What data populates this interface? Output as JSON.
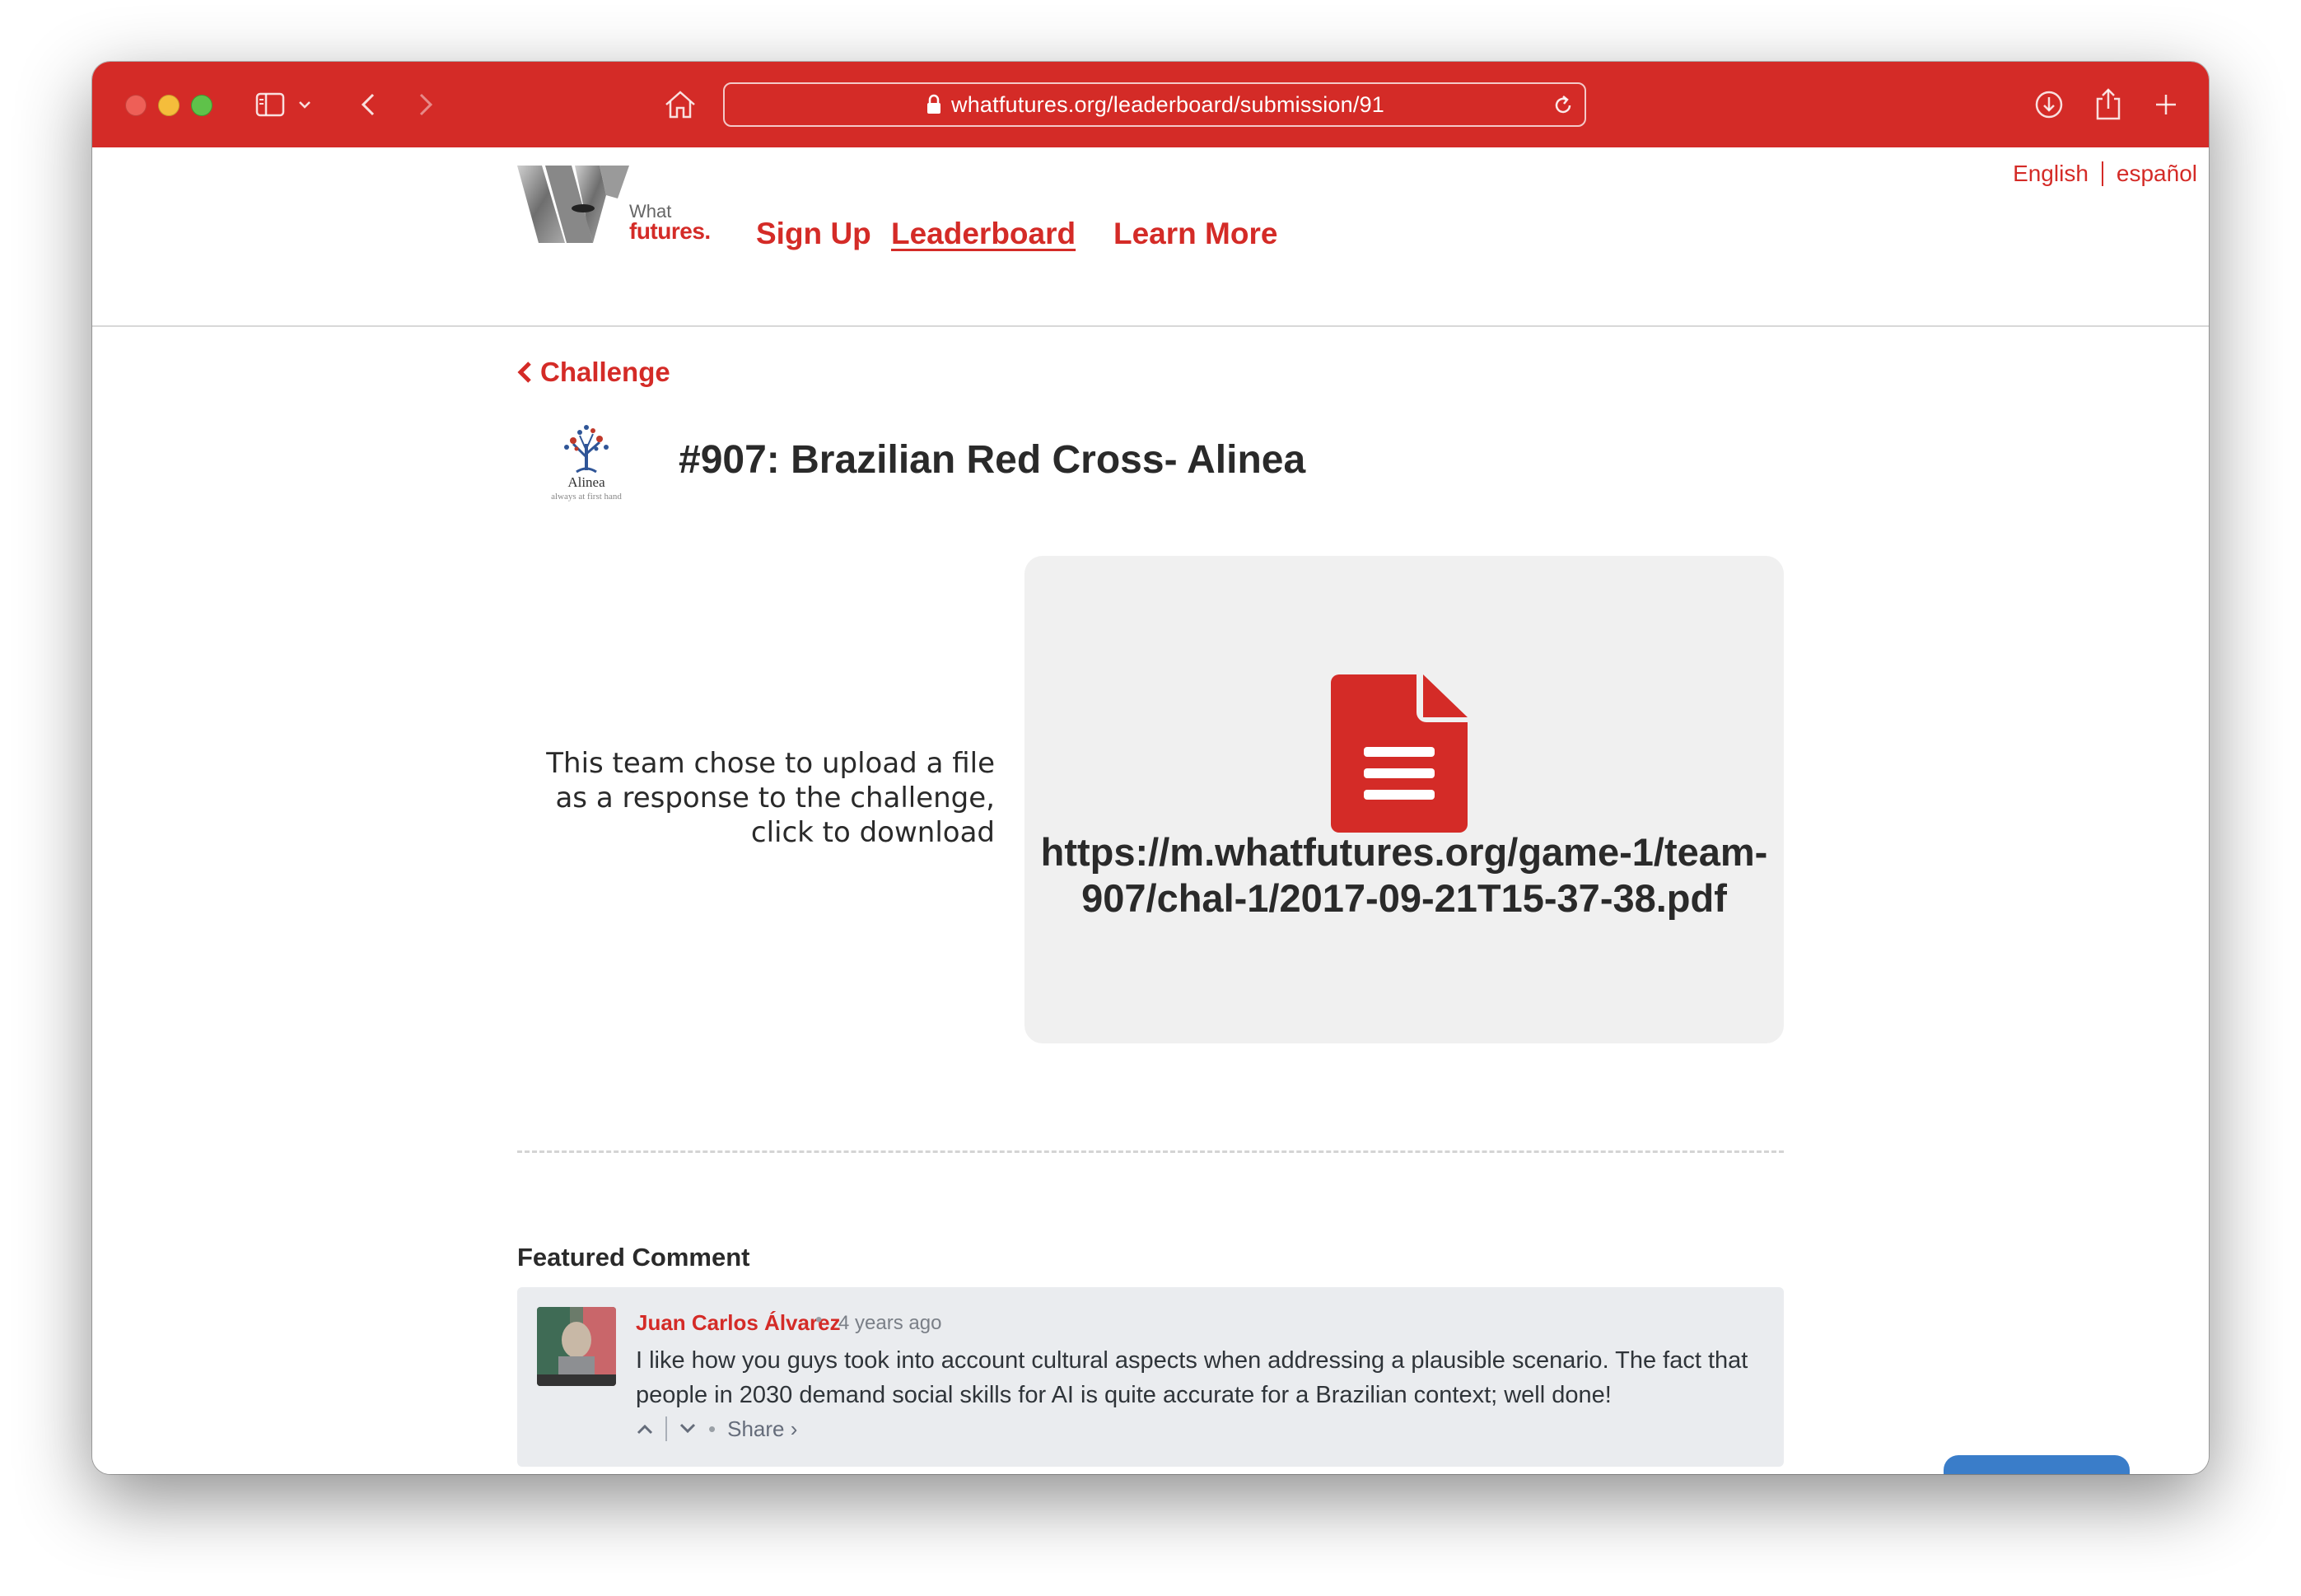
{
  "browser": {
    "url": "whatfutures.org/leaderboard/submission/91"
  },
  "header": {
    "logo_what": "What",
    "logo_futures": "futures.",
    "nav": {
      "signup": "Sign Up",
      "leaderboard": "Leaderboard",
      "learn_more": "Learn More"
    },
    "languages": {
      "english": "English",
      "spanish": "español"
    }
  },
  "content": {
    "back_label": "Challenge",
    "team_logo_name": "Alinea",
    "team_logo_tagline": "always at first hand",
    "title": "#907: Brazilian Red Cross- Alinea",
    "description": "This team chose to upload a file as a response to the challenge, click to download",
    "file_url": "https://m.whatfutures.org/game-1/team-907/chal-1/2017-09-21T15-37-38.pdf"
  },
  "featured": {
    "label": "Featured Comment",
    "comment": {
      "author": "Juan Carlos Álvarez",
      "separator": "•",
      "time": "4 years ago",
      "text": "I like how you guys took into account cultural aspects when addressing a plausible scenario. The fact that people in 2030 demand social skills for AI is quite accurate for a Brazilian context; well done!",
      "share": "Share ›"
    }
  },
  "colors": {
    "brand_red": "#d42b27",
    "toolbar_red": "#d42b27",
    "card_gray": "#f0f0f0",
    "comment_bg": "#eaecef"
  }
}
